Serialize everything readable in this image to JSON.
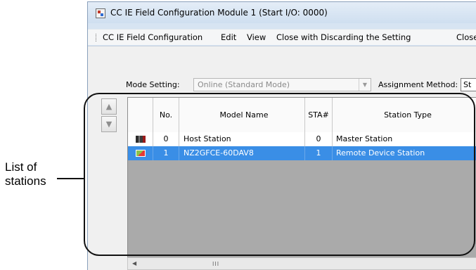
{
  "window": {
    "title": "CC IE Field Configuration Module 1 (Start I/O: 0000)"
  },
  "menu": {
    "items": [
      {
        "label": "CC IE Field Configuration"
      },
      {
        "label": "Edit"
      },
      {
        "label": "View"
      },
      {
        "label": "Close with Discarding the Setting"
      },
      {
        "label": "Close"
      }
    ]
  },
  "settings": {
    "mode_label": "Mode Setting:",
    "mode_value": "Online (Standard Mode)",
    "assignment_label": "Assignment Method:",
    "assignment_value": "St"
  },
  "table": {
    "columns": [
      "",
      "No.",
      "Model Name",
      "STA#",
      "Station Type"
    ],
    "rows": [
      {
        "icon": "station-icon",
        "no": "0",
        "model": "Host Station",
        "sta": "0",
        "type": "Master Station",
        "selected": false
      },
      {
        "icon": "remote-device-icon",
        "no": "1",
        "model": "NZ2GFCE-60DAV8",
        "sta": "1",
        "type": "Remote Device Station",
        "selected": true
      }
    ]
  },
  "side_buttons": {
    "up_icon": "arrow-up-icon",
    "down_icon": "arrow-down-icon"
  },
  "scrollbar": {
    "thumb_glyph": "III"
  },
  "annotation": {
    "line1": "List of",
    "line2": "stations"
  },
  "colors": {
    "selection": "#3a8ee6",
    "grid_background": "#aaaaaa",
    "title_bar": "#cfdff0"
  }
}
